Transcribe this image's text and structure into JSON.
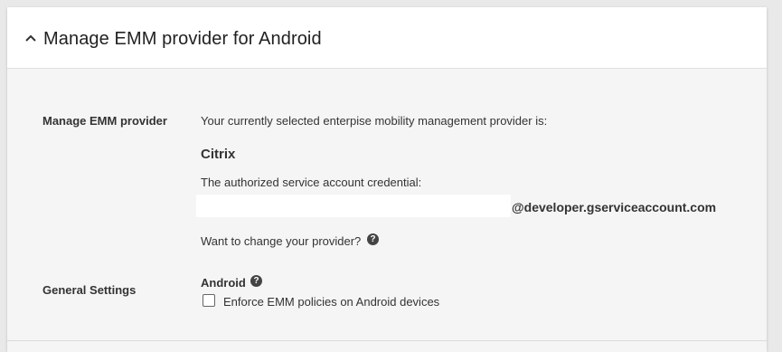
{
  "header": {
    "title": "Manage EMM provider for Android"
  },
  "emm": {
    "label": "Manage EMM provider",
    "intro_text": "Your currently selected enterpise mobility management provider is:",
    "provider_name": "Citrix",
    "credential_text": "The authorized service account credential:",
    "credential_value": "",
    "credential_domain": "@developer.gserviceaccount.com",
    "change_text": "Want to change your provider?",
    "help_icon": "question-circle-icon"
  },
  "general": {
    "label": "General Settings",
    "android_label": "Android",
    "help_icon": "question-circle-icon",
    "enforce_label": "Enforce EMM policies on Android devices",
    "enforce_checked": false
  }
}
